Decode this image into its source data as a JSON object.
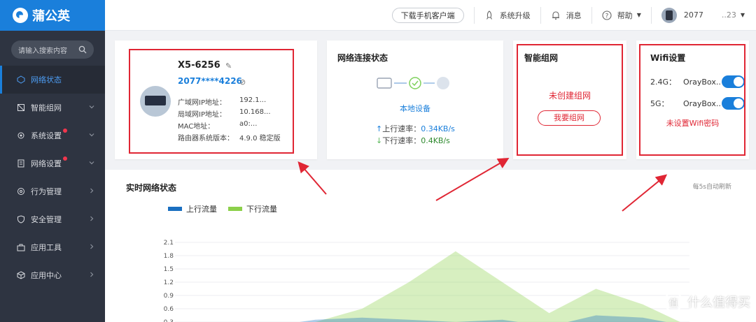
{
  "brand": {
    "name": "蒲公英"
  },
  "sidebar": {
    "search_placeholder": "请输入搜索内容",
    "items": [
      {
        "label": "网络状态",
        "active": true,
        "icon": "network-icon"
      },
      {
        "label": "智能组网",
        "icon": "mesh-icon"
      },
      {
        "label": "系统设置",
        "icon": "gear-icon",
        "badge": true
      },
      {
        "label": "网络设置",
        "icon": "document-icon",
        "badge": true
      },
      {
        "label": "行为管理",
        "icon": "behavior-icon"
      },
      {
        "label": "安全管理",
        "icon": "shield-icon"
      },
      {
        "label": "应用工具",
        "icon": "toolbox-icon"
      },
      {
        "label": "应用中心",
        "icon": "cube-icon"
      }
    ]
  },
  "topbar": {
    "download_label": "下载手机客户端",
    "upgrade_label": "系统升级",
    "message_label": "消息",
    "help_label": "帮助",
    "user_label": "2077",
    "user_suffix": "..23"
  },
  "device": {
    "name": "X5-6256",
    "sn": "2077****4226",
    "rows": [
      {
        "k": "广域网IP地址：",
        "v": "192.1..."
      },
      {
        "k": "局域网IP地址：",
        "v": "10.168..."
      },
      {
        "k": "MAC地址：",
        "v": "a0:..."
      },
      {
        "k": "路由器系统版本：",
        "v": "4.9.0 稳定版"
      }
    ]
  },
  "network": {
    "title": "网络连接状态",
    "device_label": "本地设备",
    "up_label": "上行速率：",
    "up_value": "0.34KB/s",
    "down_label": "下行速率：",
    "down_value": "0.4KB/s"
  },
  "mesh": {
    "title": "智能组网",
    "status": "未创建组网",
    "button": "我要组网"
  },
  "wifi": {
    "title": "Wifi设置",
    "bands": [
      {
        "band": "2.4G：",
        "ssid": "OrayBox...",
        "on": true
      },
      {
        "band": "5G：",
        "ssid": "OrayBox...",
        "on": true
      }
    ],
    "warning": "未设置Wifi密码"
  },
  "chart_data": {
    "type": "area",
    "title": "实时网络状态",
    "refresh_note": "每5s自动刷新",
    "yticks": [
      2.1,
      1.8,
      1.5,
      1.2,
      0.9,
      0.6,
      0.3
    ],
    "ylim": [
      0,
      2.1
    ],
    "series": [
      {
        "name": "上行流量",
        "color": "#1a6fc0",
        "values": [
          0.1,
          0.15,
          0.2,
          0.35,
          0.4,
          0.35,
          0.3,
          0.35,
          0.2,
          0.45,
          0.4,
          0.2
        ]
      },
      {
        "name": "下行流量",
        "color": "#8cd04a",
        "values": [
          0.05,
          0.1,
          0.15,
          0.3,
          0.6,
          1.2,
          1.9,
          1.2,
          0.5,
          1.05,
          0.7,
          0.2
        ]
      }
    ]
  },
  "watermark": {
    "text": "什么值得买",
    "icon": "值"
  }
}
